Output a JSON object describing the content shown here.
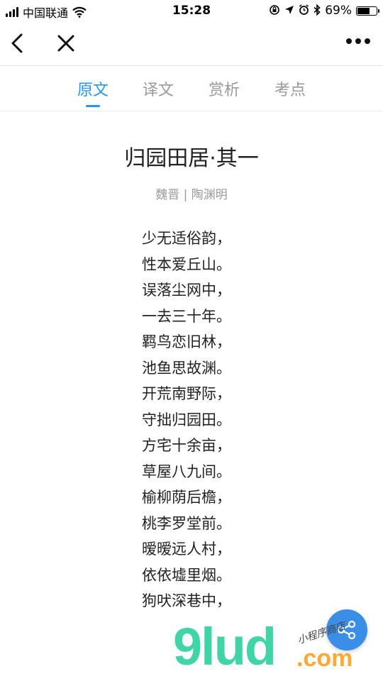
{
  "status_bar": {
    "carrier": "中国联通",
    "time": "15:28",
    "battery_percent": "69%",
    "battery_level": 0.69
  },
  "nav": {
    "back_icon": "chevron-left-icon",
    "close_icon": "close-icon",
    "more_icon": "more-dots-icon"
  },
  "tabs": [
    {
      "label": "原文",
      "active": true
    },
    {
      "label": "译文",
      "active": false
    },
    {
      "label": "赏析",
      "active": false
    },
    {
      "label": "考点",
      "active": false
    }
  ],
  "poem": {
    "title": "归园田居·其一",
    "author": "魏晋 | 陶渊明",
    "lines": [
      "少无适俗韵，",
      "性本爱丘山。",
      "误落尘网中，",
      "一去三十年。",
      "羁鸟恋旧林，",
      "池鱼思故渊。",
      "开荒南野际，",
      "守拙归园田。",
      "方宅十余亩，",
      "草屋八九间。",
      "榆柳荫后檐，",
      "桃李罗堂前。",
      "暧暧远人村，",
      "依依墟里烟。",
      "狗吠深巷中，"
    ]
  },
  "share": {
    "icon": "share-icon"
  },
  "watermark": {
    "brand": "9lud",
    "suffix": ".com",
    "tagline": "小程序商店"
  },
  "colors": {
    "accent": "#2196f3",
    "share_bg": "#3a8ee6",
    "muted": "#9a9a9a"
  }
}
